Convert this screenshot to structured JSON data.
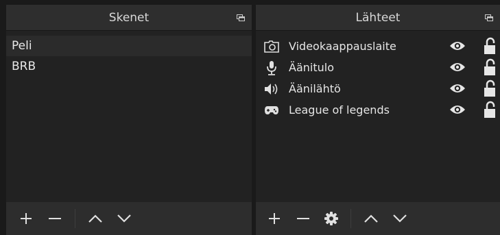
{
  "scenes_dock": {
    "title": "Skenet",
    "items": [
      {
        "label": "Peli",
        "selected": true
      },
      {
        "label": "BRB",
        "selected": false
      }
    ],
    "toolbar": [
      "add-icon",
      "remove-icon",
      "move-up-icon",
      "move-down-icon"
    ]
  },
  "sources_dock": {
    "title": "Lähteet",
    "items": [
      {
        "label": "Videokaappauslaite",
        "icon": "camera-icon",
        "visible": true,
        "locked": false
      },
      {
        "label": "Äänitulo",
        "icon": "microphone-icon",
        "visible": true,
        "locked": false
      },
      {
        "label": "Äänilähtö",
        "icon": "speaker-icon",
        "visible": true,
        "locked": false
      },
      {
        "label": "League of legends",
        "icon": "gamepad-icon",
        "visible": true,
        "locked": false
      }
    ],
    "toolbar": [
      "add-icon",
      "remove-icon",
      "settings-icon",
      "move-up-icon",
      "move-down-icon"
    ]
  },
  "colors": {
    "background": "#1a1a1a",
    "panel": "#222222",
    "title_bar": "#2e2e2e",
    "toolbar": "#2d2d2d",
    "selected_row": "#2b2b2b",
    "text": "#e6e6e6",
    "icon": "#e0e0e0"
  }
}
